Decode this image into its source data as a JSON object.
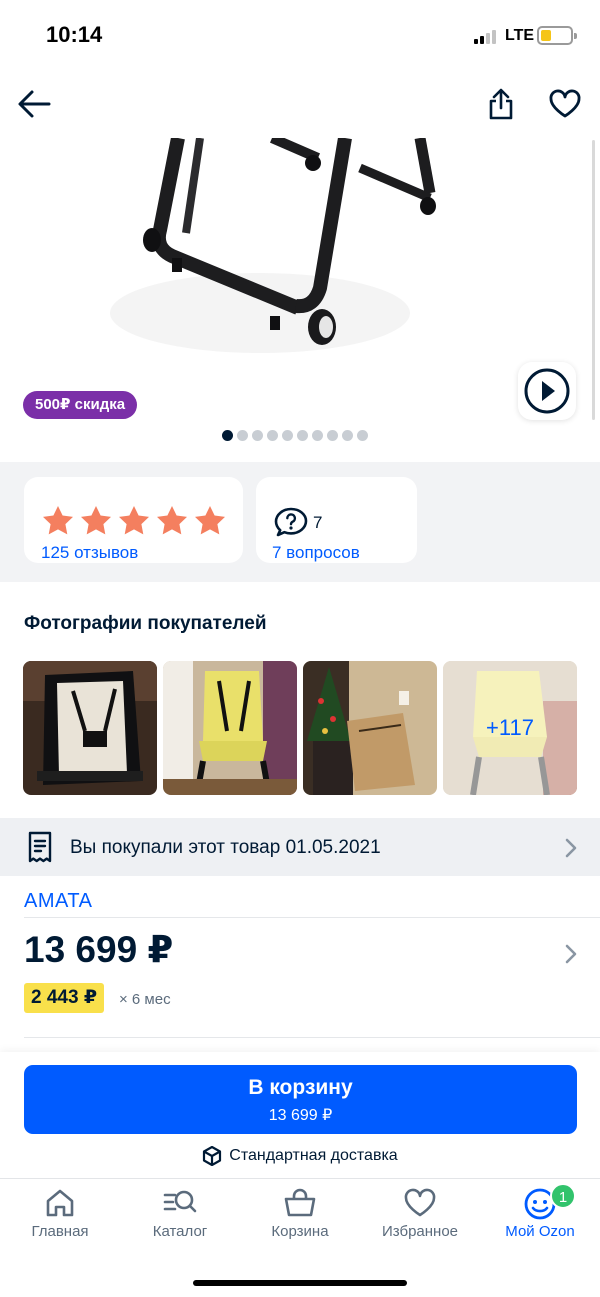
{
  "status_bar": {
    "time": "10:14",
    "network": "LTE"
  },
  "product": {
    "discount_badge": "500₽ скидка",
    "gallery_count": 10,
    "gallery_active_index": 0
  },
  "rating": {
    "stars": 5,
    "reviews_label": "125 отзывов"
  },
  "questions": {
    "count": "7",
    "label": "7 вопросов"
  },
  "customer_photos": {
    "title": "Фотографии покупателей",
    "more_label": "+117"
  },
  "purchased": {
    "text": "Вы покупали этот товар 01.05.2021"
  },
  "seller": {
    "name": "AMATA"
  },
  "price": {
    "current": "13 699 ₽",
    "installment": "2 443 ₽",
    "installment_term": "× 6 мес"
  },
  "cart": {
    "button_label": "В корзину",
    "button_price": "13 699 ₽",
    "delivery": "Стандартная доставка"
  },
  "tabs": [
    {
      "label": "Главная",
      "icon": "home-icon"
    },
    {
      "label": "Каталог",
      "icon": "catalog-icon"
    },
    {
      "label": "Корзина",
      "icon": "cart-icon"
    },
    {
      "label": "Избранное",
      "icon": "heart-icon"
    },
    {
      "label": "Мой Ozon",
      "icon": "profile-icon",
      "badge": "1",
      "active": true
    }
  ],
  "colors": {
    "accent": "#005bff",
    "discount_badge": "#7b2fa8",
    "star": "#f47f5f",
    "installment_bg": "#f9e04b",
    "badge": "#32c36c"
  }
}
